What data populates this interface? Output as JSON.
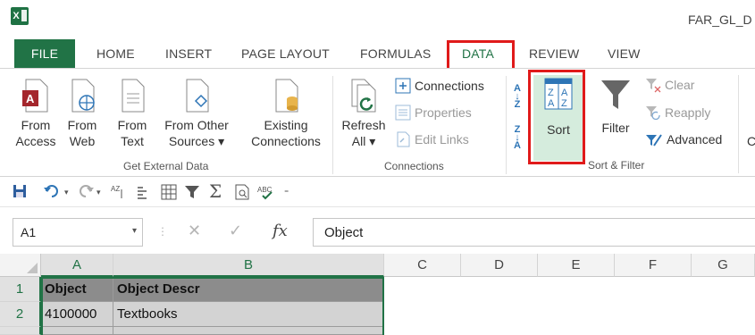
{
  "app": {
    "icon_label": "X",
    "doc_title": "FAR_GL_D"
  },
  "tabs": [
    "FILE",
    "HOME",
    "INSERT",
    "PAGE LAYOUT",
    "FORMULAS",
    "DATA",
    "REVIEW",
    "VIEW"
  ],
  "ribbon": {
    "get_external": {
      "label": "Get External Data",
      "from_access": [
        "From",
        "Access"
      ],
      "from_web": [
        "From",
        "Web"
      ],
      "from_text": [
        "From",
        "Text"
      ],
      "from_other": [
        "From Other",
        "Sources ▾"
      ],
      "existing": [
        "Existing",
        "Connections"
      ]
    },
    "connections": {
      "label": "Connections",
      "refresh": [
        "Refresh",
        "All ▾"
      ],
      "connections": "Connections",
      "properties": "Properties",
      "edit_links": "Edit Links"
    },
    "sort_filter": {
      "label": "Sort & Filter",
      "sort": "Sort",
      "filter": "Filter",
      "clear": "Clear",
      "reapply": "Reapply",
      "advanced": "Advanced",
      "sort_az_glyph": "A↓Z",
      "sort_za_glyph": "Z↓A",
      "next_partial": "C"
    }
  },
  "formula_bar": {
    "name_box": "A1",
    "formula": "Object",
    "fx": "fx"
  },
  "grid": {
    "columns": [
      "A",
      "B",
      "C",
      "D",
      "E",
      "F",
      "G"
    ],
    "rows": [
      {
        "num": "1",
        "a": "Object",
        "b": "Object Descr"
      },
      {
        "num": "2",
        "a": "4100000",
        "b": "Textbooks"
      }
    ]
  },
  "colors": {
    "excel_green": "#217346",
    "highlight_red": "#e01a1a",
    "sort_highlight": "#d5ecdd"
  }
}
